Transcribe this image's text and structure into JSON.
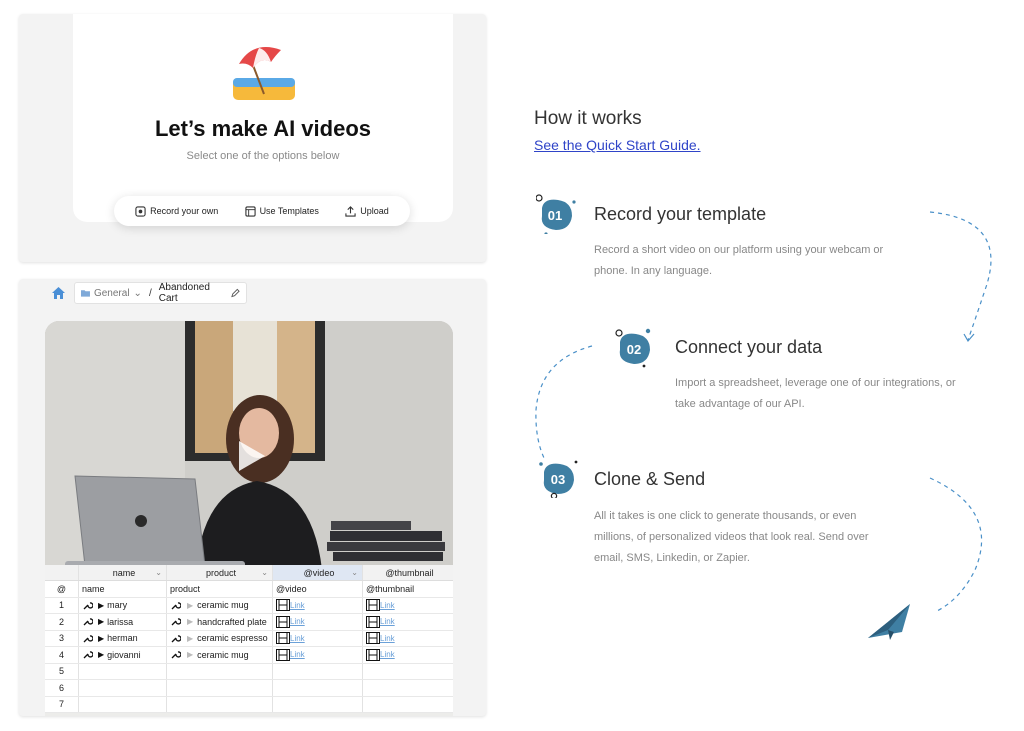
{
  "maker": {
    "title": "Let’s make AI videos",
    "subtitle": "Select one of the options below",
    "options": [
      {
        "label": "Record your own"
      },
      {
        "label": "Use Templates"
      },
      {
        "label": "Upload"
      }
    ]
  },
  "editor": {
    "breadcrumb": {
      "folder": "General",
      "separator": "/",
      "current": "Abandoned Cart"
    },
    "grid": {
      "columns": [
        "name",
        "product",
        "@video",
        "@thumbnail"
      ],
      "row_header": [
        "@",
        "name",
        "product",
        "@video",
        "@thumbnail"
      ],
      "rows": [
        {
          "num": "1",
          "name": "mary",
          "product": "ceramic mug",
          "video": "Link",
          "thumbnail": "Link"
        },
        {
          "num": "2",
          "name": "larissa",
          "product": "handcrafted plate",
          "video": "Link",
          "thumbnail": "Link"
        },
        {
          "num": "3",
          "name": "herman",
          "product": "ceramic espresso",
          "video": "Link",
          "thumbnail": "Link"
        },
        {
          "num": "4",
          "name": "giovanni",
          "product": "ceramic mug",
          "video": "Link",
          "thumbnail": "Link"
        },
        {
          "num": "5",
          "name": "",
          "product": "",
          "video": "",
          "thumbnail": ""
        },
        {
          "num": "6",
          "name": "",
          "product": "",
          "video": "",
          "thumbnail": ""
        },
        {
          "num": "7",
          "name": "",
          "product": "",
          "video": "",
          "thumbnail": ""
        }
      ]
    }
  },
  "how": {
    "title": "How it works",
    "guide_link": "See the Quick Start Guide.",
    "steps": [
      {
        "number": "01",
        "title": "Record your template",
        "desc_lines": [
          "Record a short video on our platform using your webcam or",
          "phone. In any language."
        ]
      },
      {
        "number": "02",
        "title": "Connect your data",
        "desc_lines": [
          "Import a spreadsheet, leverage one of our integrations, or",
          "take advantage of our API."
        ]
      },
      {
        "number": "03",
        "title": "Clone & Send",
        "desc_lines": [
          "All it takes is one click to generate thousands, or even",
          "millions, of personalized videos that look real. Send over",
          "email, SMS, Linkedin, or Zapier."
        ]
      }
    ]
  },
  "colors": {
    "badge": "#3f7fa3",
    "link": "#2f44c8",
    "dashed": "#4a90c8"
  },
  "icons": [
    "beach-umbrella-icon",
    "record-icon",
    "template-icon",
    "upload-icon",
    "home-icon",
    "folder-icon",
    "pencil-icon",
    "play-icon",
    "wrench-icon",
    "film-icon",
    "paper-plane-icon"
  ]
}
